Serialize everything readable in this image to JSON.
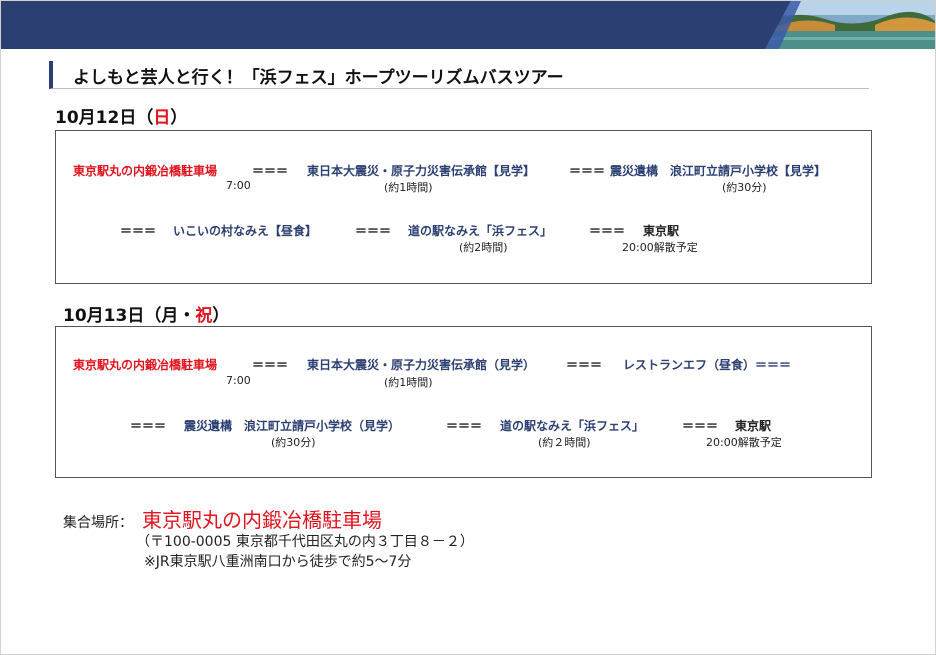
{
  "title": "よしもと芸人と行く！「浜フェス」ホープツーリズムバスツアー",
  "day1": {
    "date_prefix": "10月12日（",
    "date_day": "日",
    "date_suffix": "）",
    "row1": {
      "start": "東京駅丸の内鍛冶橋駐車場",
      "sep1": "＝＝＝",
      "stop1": "東日本大震災・原子力災害伝承館【見学】",
      "sep2": "＝＝＝",
      "stop2": "震災遺構　浪江町立請戸小学校【見学】",
      "time_start": "7:00",
      "dur1": "(約1時間)",
      "dur2": "(約30分)"
    },
    "row2": {
      "sep0": "＝＝＝",
      "stop3": "いこいの村なみえ【昼食】",
      "sep1": "＝＝＝",
      "stop4": "道の駅なみえ「浜フェス」",
      "sep2": "＝＝＝",
      "end": "東京駅",
      "dur4": "(約2時間)",
      "end_time": "20:00解散予定"
    }
  },
  "day2": {
    "date_prefix": "10月13日（月・",
    "date_day": "祝",
    "date_suffix": "）",
    "row1": {
      "start": "東京駅丸の内鍛冶橋駐車場",
      "sep1": "＝＝＝",
      "stop1": "東日本大震災・原子力災害伝承館（見学）",
      "sep2": "＝＝＝",
      "stop2": "レストランエフ（昼食）＝＝＝",
      "time_start": "7:00",
      "dur1": "(約1時間)"
    },
    "row2": {
      "sep0": "＝＝＝",
      "stop3": "震災遺構　浪江町立請戸小学校（見学）",
      "sep1": "＝＝＝",
      "stop4": "道の駅なみえ「浜フェス」",
      "sep2": "＝＝＝",
      "end": "東京駅",
      "dur3": "(約30分)",
      "dur4": "(約２時間)",
      "end_time": "20:00解散予定"
    }
  },
  "meeting": {
    "label": "集合場所：",
    "name": "東京駅丸の内鍛冶橋駐車場",
    "address": "（〒100-0005 東京都千代田区丸の内３丁目８－２）",
    "access": "※JR東京駅八重洲南口から徒歩で約5～7分"
  },
  "colors": {
    "navy": "#2b3f72",
    "red": "#e0141e"
  }
}
